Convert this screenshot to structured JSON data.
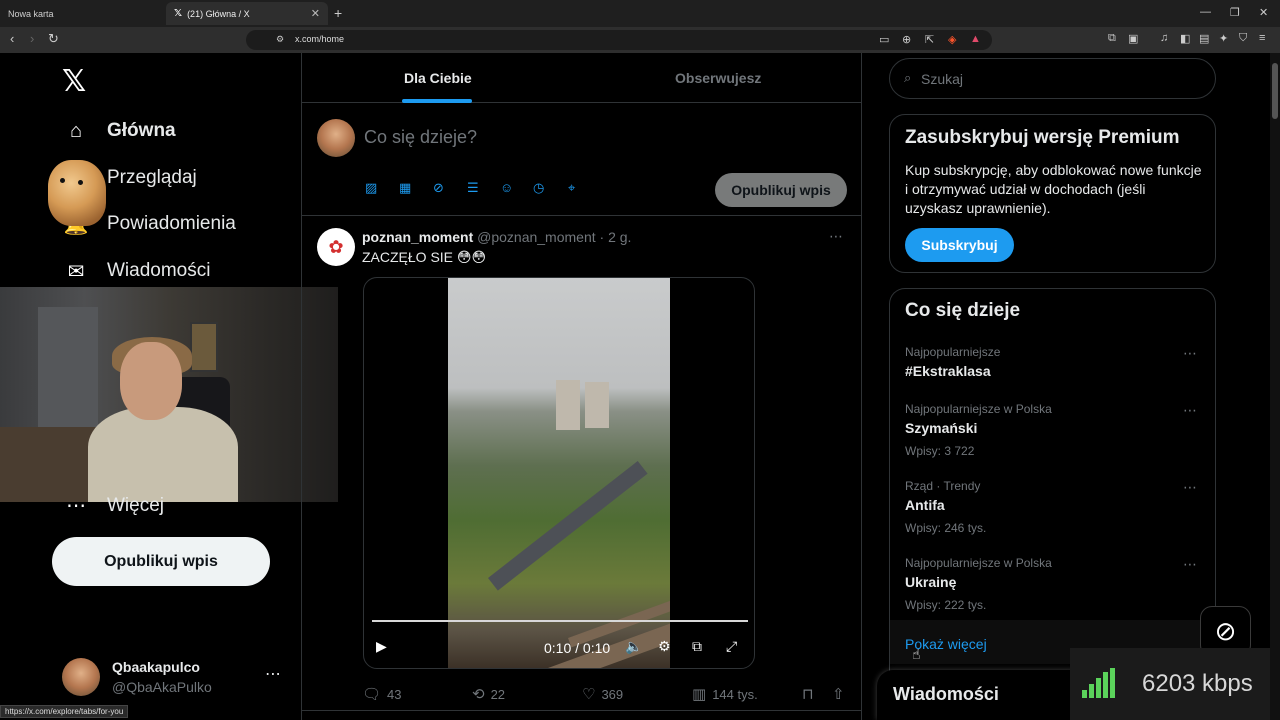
{
  "browser": {
    "tabs": [
      {
        "label": "Nowa karta",
        "active": false
      },
      {
        "label": "(21) Główna / X",
        "active": true
      }
    ],
    "url": "x.com/home",
    "status_url": "https://x.com/explore/tabs/for-you"
  },
  "sidebar": {
    "items": [
      {
        "label": "Główna",
        "icon": "home-icon",
        "glyph": "⌂"
      },
      {
        "label": "Przeglądaj",
        "icon": "search-icon",
        "glyph": "⌕"
      },
      {
        "label": "Powiadomienia",
        "icon": "bell-icon",
        "glyph": "🔔"
      },
      {
        "label": "Wiadomości",
        "icon": "mail-icon",
        "glyph": "✉"
      }
    ],
    "more_label": "Więcej",
    "post_button": "Opublikuj wpis",
    "profile": {
      "name": "Qbaakapulco",
      "handle": "@QbaAkaPulko"
    }
  },
  "feed": {
    "tabs": [
      {
        "label": "Dla Ciebie",
        "active": true
      },
      {
        "label": "Obserwujesz",
        "active": false
      }
    ],
    "compose": {
      "placeholder": "Co się dzieje?",
      "button": "Opublikuj wpis"
    },
    "post": {
      "display_name": "poznan_moment",
      "handle": "@poznan_moment",
      "time": "· 2 g.",
      "text": "ZACZĘŁO SIE 😳😳",
      "video_time": "0:10 / 0:10",
      "video_progress": 1.0,
      "replies": "43",
      "reposts": "22",
      "likes": "369",
      "views": "144 tys."
    }
  },
  "right": {
    "search_placeholder": "Szukaj",
    "premium": {
      "title": "Zasubskrybuj wersję Premium",
      "text": "Kup subskrypcję, aby odblokować nowe funkcje i otrzymywać udział w dochodach (jeśli uzyskasz uprawnienie).",
      "button": "Subskrybuj"
    },
    "trends": {
      "title": "Co się dzieje",
      "items": [
        {
          "context": "Najpopularniejsze",
          "name": "#Ekstraklasa",
          "count": ""
        },
        {
          "context": "Najpopularniejsze w Polska",
          "name": "Szymański",
          "count": "Wpisy: 3 722"
        },
        {
          "context": "Rząd · Trendy",
          "name": "Antifa",
          "count": "Wpisy: 246 tys."
        },
        {
          "context": "Najpopularniejsze w Polska",
          "name": "Ukrainę",
          "count": "Wpisy: 222 tys."
        }
      ],
      "show_more": "Pokaż więcej"
    },
    "messages_label": "Wiadomości"
  },
  "overlay": {
    "bitrate": "6203 kbps"
  },
  "colors": {
    "accent": "#1d9bf0",
    "background": "#000000",
    "muted": "#71767b",
    "text": "#e7e9ea"
  }
}
